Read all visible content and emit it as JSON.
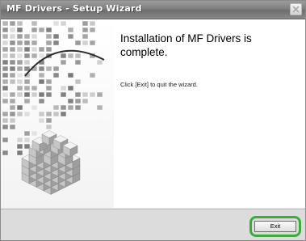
{
  "window": {
    "title": "MF Drivers - Setup Wizard"
  },
  "main": {
    "heading": "Installation of MF Drivers is complete.",
    "instruction": "Click [Exit] to quit the wizard."
  },
  "footer": {
    "exit_label": "Exit"
  },
  "icons": {
    "close": "close-icon",
    "illustration": "cube-blocks-illustration"
  },
  "colors": {
    "titlebar": "#7f7f7f",
    "highlight": "#3cad3c"
  }
}
